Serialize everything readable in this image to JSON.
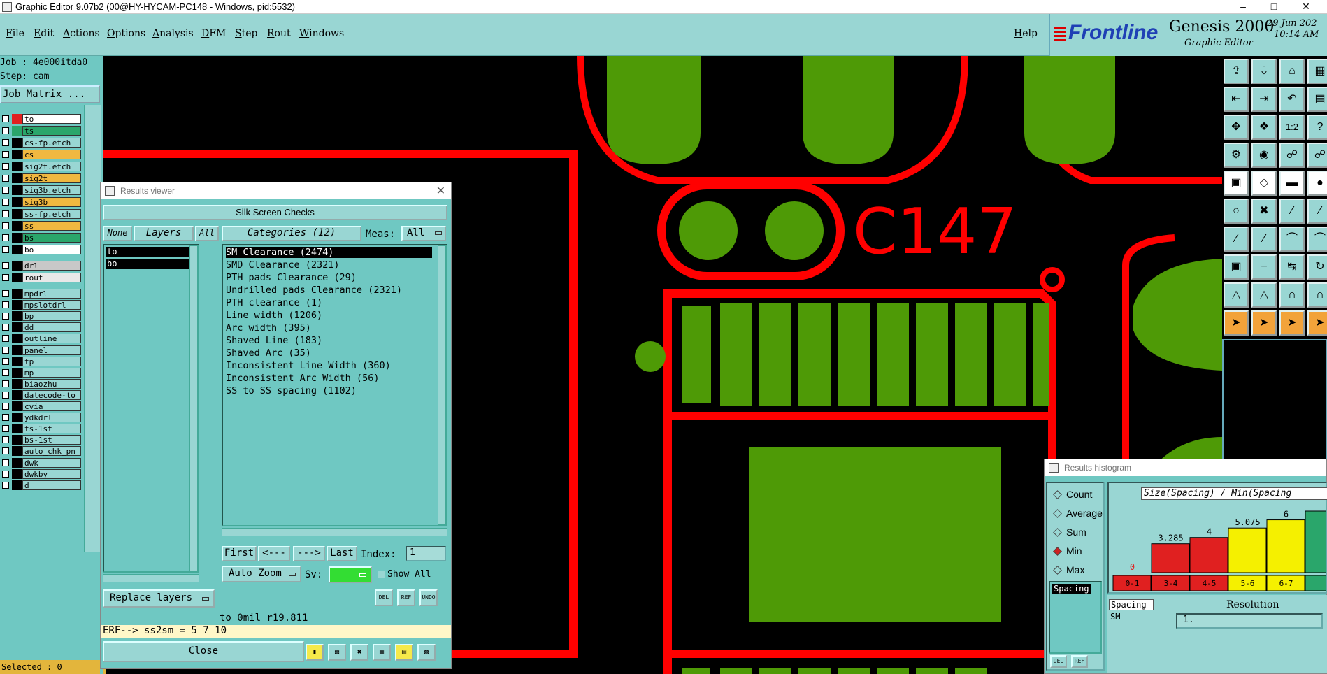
{
  "window": {
    "title": "Graphic Editor 9.07b2 (00@HY-HYCAM-PC148 - Windows, pid:5532)"
  },
  "menu": {
    "items": [
      "File",
      "Edit",
      "Actions",
      "Options",
      "Analysis",
      "DFM",
      "Step",
      "Rout",
      "Windows"
    ],
    "help": "Help"
  },
  "brand": {
    "logo": "Frontline",
    "product": "Genesis 2000",
    "subtitle": "Graphic Editor",
    "date": "29 Jun 202",
    "time": "10:14 AM"
  },
  "left": {
    "job": "Job : 4e000itda0",
    "step": "Step: cam",
    "job_matrix": "Job Matrix ...",
    "layers": [
      {
        "name": "to",
        "color": "#ffffff",
        "swatch": "#e02020"
      },
      {
        "name": "ts",
        "color": "#2aa66b",
        "swatch": "#2aa66b"
      },
      {
        "name": "cs-fp.etch",
        "color": "#99d6d3",
        "swatch": "#000000"
      },
      {
        "name": "cs",
        "color": "#f0b840",
        "swatch": "#000000"
      },
      {
        "name": "sig2t.etch",
        "color": "#99d6d3",
        "swatch": "#000000"
      },
      {
        "name": "sig2t",
        "color": "#f0b840",
        "swatch": "#000000"
      },
      {
        "name": "sig3b.etch",
        "color": "#99d6d3",
        "swatch": "#000000"
      },
      {
        "name": "sig3b",
        "color": "#f0b840",
        "swatch": "#000000"
      },
      {
        "name": "ss-fp.etch",
        "color": "#99d6d3",
        "swatch": "#000000"
      },
      {
        "name": "ss",
        "color": "#f0b840",
        "swatch": "#000000"
      },
      {
        "name": "bs",
        "color": "#2aa66b",
        "swatch": "#000000"
      },
      {
        "name": "bo",
        "color": "#ffffff",
        "swatch": "#000000"
      },
      {
        "name": "drl",
        "color": "#c8c8c8",
        "swatch": "#000000"
      },
      {
        "name": "rout",
        "color": "#e8e8e8",
        "swatch": "#000000"
      },
      {
        "name": "mpdrl",
        "color": "#99d6d3",
        "swatch": "#000000"
      },
      {
        "name": "mpslotdrl",
        "color": "#99d6d3",
        "swatch": "#000000"
      },
      {
        "name": "bp",
        "color": "#99d6d3",
        "swatch": "#000000"
      },
      {
        "name": "dd",
        "color": "#99d6d3",
        "swatch": "#000000"
      },
      {
        "name": "outline",
        "color": "#99d6d3",
        "swatch": "#000000"
      },
      {
        "name": "panel",
        "color": "#99d6d3",
        "swatch": "#000000"
      },
      {
        "name": "tp",
        "color": "#99d6d3",
        "swatch": "#000000"
      },
      {
        "name": "mp",
        "color": "#99d6d3",
        "swatch": "#000000"
      },
      {
        "name": "biaozhu",
        "color": "#99d6d3",
        "swatch": "#000000"
      },
      {
        "name": "datecode-to",
        "color": "#99d6d3",
        "swatch": "#000000"
      },
      {
        "name": "cvia",
        "color": "#99d6d3",
        "swatch": "#000000"
      },
      {
        "name": "ydkdrl",
        "color": "#99d6d3",
        "swatch": "#000000"
      },
      {
        "name": "ts-1st",
        "color": "#99d6d3",
        "swatch": "#000000"
      },
      {
        "name": "bs-1st",
        "color": "#99d6d3",
        "swatch": "#000000"
      },
      {
        "name": "auto_chk_pn",
        "color": "#99d6d3",
        "swatch": "#000000"
      },
      {
        "name": "dwk",
        "color": "#99d6d3",
        "swatch": "#000000"
      },
      {
        "name": "dwkby",
        "color": "#99d6d3",
        "swatch": "#000000"
      },
      {
        "name": "d",
        "color": "#99d6d3",
        "swatch": "#000000"
      }
    ],
    "selected": "Selected : 0"
  },
  "canvas": {
    "ref_designator": "C147"
  },
  "results_viewer": {
    "title": "Results viewer",
    "heading": "Silk Screen Checks",
    "none_label": "None",
    "layers_label": "Layers",
    "all_label": "All",
    "categories_label": "Categories (12)",
    "meas_label": "Meas:",
    "meas_value": "All",
    "layers": [
      "to",
      "bo"
    ],
    "categories": [
      "SM Clearance (2474)",
      "SMD Clearance (2321)",
      "PTH pads Clearance (29)",
      "Undrilled pads Clearance (2321)",
      "PTH clearance (1)",
      "Line width (1206)",
      "Arc width (395)",
      "Shaved Line (183)",
      "Shaved Arc (35)",
      "Inconsistent Line Width (360)",
      "Inconsistent Arc Width (56)",
      "SS to SS spacing (1102)"
    ],
    "nav": {
      "first": "First",
      "prev": "<---",
      "next": "--->",
      "last": "Last",
      "index_label": "Index:",
      "index_value": "1"
    },
    "auto_zoom": "Auto Zoom",
    "sv_label": "Sv:",
    "show_all": "Show All",
    "replace_layers": "Replace layers",
    "small_buttons": [
      "DEL",
      "REF",
      "UNDO"
    ],
    "status": "to 0mil  r19.811",
    "erf": "ERF--> ss2sm = 5 7 10",
    "close": "Close"
  },
  "histogram": {
    "title": "Results histogram",
    "modes": [
      "Count",
      "Average",
      "Sum",
      "Min",
      "Max"
    ],
    "selected_mode": "Min",
    "list_item": "Spacing",
    "chart_title": "Size(Spacing) / Min(Spacing",
    "spacing_label": "Spacing",
    "sm_label": "SM",
    "resolution_label": "Resolution",
    "resolution_value": "1.",
    "small_buttons": [
      "DEL",
      "REF"
    ]
  },
  "chart_data": {
    "type": "bar",
    "title": "Size(Spacing) / Min(Spacing",
    "categories": [
      "0-1",
      "3-4",
      "4-5",
      "5-6",
      "6-7",
      ""
    ],
    "values": [
      0,
      3.285,
      4,
      5.075,
      6,
      7
    ],
    "value_labels": [
      "0",
      "3.285",
      "4",
      "5.075",
      "6",
      ""
    ],
    "colors": [
      "#e02020",
      "#e02020",
      "#e02020",
      "#f5f000",
      "#f5f000",
      "#2aa66b"
    ],
    "ylim": [
      0,
      7
    ]
  }
}
